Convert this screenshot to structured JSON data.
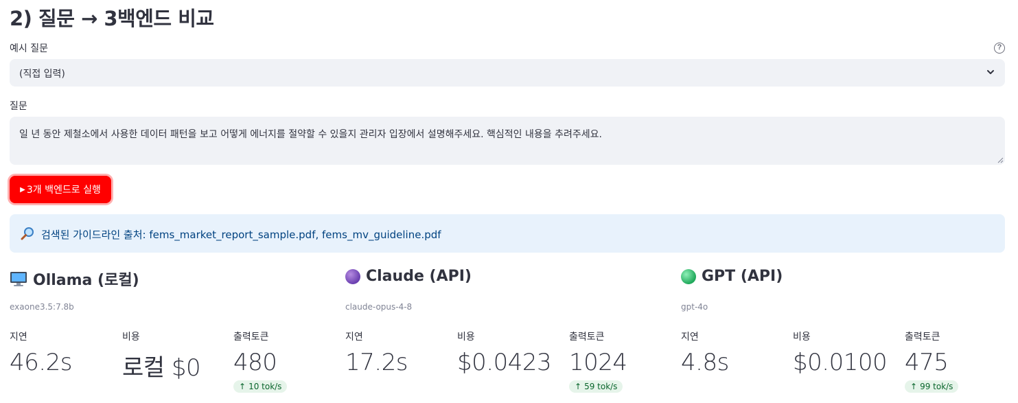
{
  "section": {
    "title": "2) 질문 → 3백엔드 비교"
  },
  "example_select": {
    "label": "예시 질문",
    "value": "(직접 입력)"
  },
  "question": {
    "label": "질문",
    "value": "일 년 동안 제철소에서 사용한 데이터 패턴을 보고 어떻게 에너지를 절약할 수 있을지 관리자 입장에서 설명해주세요. 핵심적인 내용을 추려주세요."
  },
  "run_button": {
    "label": "3개 백엔드로 실행",
    "icon": "▶"
  },
  "sources": {
    "prefix": "검색된 가이드라인 출처:",
    "files": "fems_market_report_sample.pdf, fems_mv_guideline.pdf"
  },
  "backends": [
    {
      "title": "Ollama (로컬)",
      "icon": "monitor-icon",
      "model": "exaone3.5:7.8b",
      "latency_label": "지연",
      "latency": "46.2s",
      "cost_label": "비용",
      "cost": "로컬 $0",
      "tokens_label": "출력토큰",
      "tokens": "480",
      "rate": "10 tok/s"
    },
    {
      "title": "Claude (API)",
      "icon": "purple-circle-icon",
      "model": "claude-opus-4-8",
      "latency_label": "지연",
      "latency": "17.2s",
      "cost_label": "비용",
      "cost": "$0.0423",
      "tokens_label": "출력토큰",
      "tokens": "1024",
      "rate": "59 tok/s"
    },
    {
      "title": "GPT (API)",
      "icon": "green-circle-icon",
      "model": "gpt-4o",
      "latency_label": "지연",
      "latency": "4.8s",
      "cost_label": "비용",
      "cost": "$0.0100",
      "tokens_label": "출력토큰",
      "tokens": "475",
      "rate": "99 tok/s"
    }
  ],
  "colors": {
    "primary": "#ff0000",
    "info_bg": "#e8f2fc",
    "info_text": "#004280",
    "input_bg": "#f0f2f6",
    "delta_bg": "#e6f4ea",
    "delta_text": "#09652b"
  }
}
